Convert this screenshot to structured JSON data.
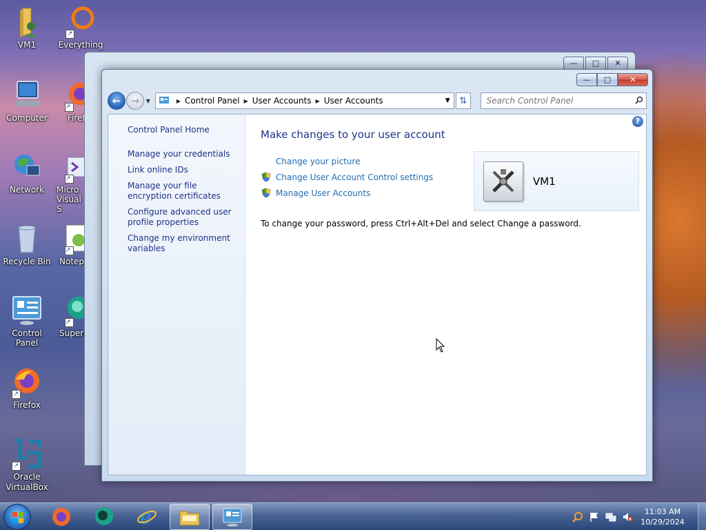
{
  "desktop": {
    "icons": [
      {
        "label": "VM1"
      },
      {
        "label": "Everything"
      },
      {
        "label": "Computer"
      },
      {
        "label": "Firef"
      },
      {
        "label": "Network"
      },
      {
        "label": "Micro Visual S"
      },
      {
        "label": "Recycle Bin"
      },
      {
        "label": "Notepa"
      },
      {
        "label": "Control Panel"
      },
      {
        "label": "Supern"
      },
      {
        "label": "Firefox"
      },
      {
        "label": "Oracle VirtualBox"
      }
    ]
  },
  "window": {
    "address": {
      "crumbs": [
        "Control Panel",
        "User Accounts",
        "User Accounts"
      ]
    },
    "search": {
      "placeholder": "Search Control Panel"
    },
    "left_pane": {
      "home": "Control Panel Home",
      "links": [
        "Manage your credentials",
        "Link online IDs",
        "Manage your file encryption certificates",
        "Configure advanced user profile properties",
        "Change my environment variables"
      ]
    },
    "main": {
      "heading": "Make changes to your user account",
      "tasks": [
        {
          "label": "Change your picture",
          "shield": false
        },
        {
          "label": "Change User Account Control settings",
          "shield": true
        },
        {
          "label": "Manage User Accounts",
          "shield": true
        }
      ],
      "note": "To change your password, press Ctrl+Alt+Del and select Change a password.",
      "user": {
        "name": "VM1"
      }
    }
  },
  "taskbar": {
    "clock": {
      "time": "11:03 AM",
      "date": "10/29/2024"
    }
  },
  "colors": {
    "link": "#1e3287",
    "task_link": "#1e6cb2",
    "close_button": "#c43a2b"
  }
}
